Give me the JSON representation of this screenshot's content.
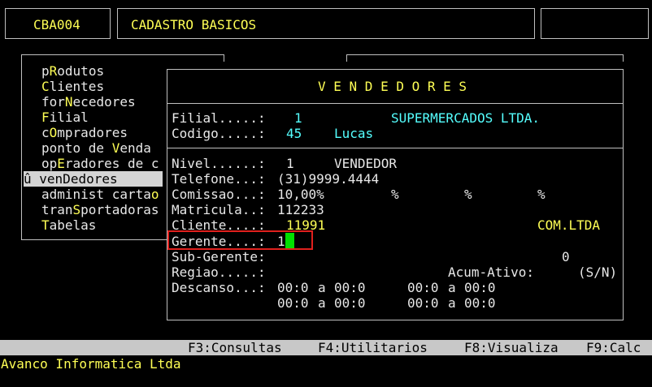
{
  "header": {
    "code": "CBA004",
    "title": "CADASTRO BASICOS"
  },
  "menu": {
    "items": [
      {
        "pre": "p",
        "key": "R",
        "post": "odutos"
      },
      {
        "pre": "",
        "key": "C",
        "post": "lientes"
      },
      {
        "pre": "for",
        "key": "N",
        "post": "ecedores"
      },
      {
        "pre": "",
        "key": "F",
        "post": "ilial"
      },
      {
        "pre": "c",
        "key": "O",
        "post": "mpradores"
      },
      {
        "pre": "ponto de ",
        "key": "V",
        "post": "enda"
      },
      {
        "pre": "op",
        "key": "E",
        "post": "radores de c"
      },
      {
        "pre": "",
        "key": "",
        "post": ""
      },
      {
        "pre": "administ carta",
        "key": "o",
        "post": ""
      },
      {
        "pre": "tran",
        "key": "S",
        "post": "portadoras"
      },
      {
        "pre": "",
        "key": "T",
        "post": "abelas"
      }
    ],
    "selected_marker": "û",
    "selected_label": "venDedores"
  },
  "dialog": {
    "title": "V E N D E D O R E S",
    "filial_label": "Filial.....:",
    "filial_value": "1",
    "filial_name": "SUPERMERCADOS LTDA.",
    "codigo_label": "Codigo.....:",
    "codigo_value": "45",
    "codigo_name": "Lucas",
    "nivel_label": "Nivel......:",
    "nivel_value": "1",
    "nivel_desc": "VENDEDOR",
    "telefone_label": "Telefone...:",
    "telefone_value": "(31)9999.4444",
    "comissao_label": "Comissao...:",
    "comissao_value": "10,00%",
    "pct1": "%",
    "pct2": "%",
    "pct3": "%",
    "matricula_label": "Matricula..:",
    "matricula_value": "112233",
    "cliente_label": "Cliente....:",
    "cliente_value": "11991",
    "cliente_name": "COM.LTDA",
    "gerente_label": "Gerente....:",
    "gerente_value": "1",
    "gerente_underscore": "_",
    "subgerente_label": "Sub-Gerente:",
    "subgerente_value": "0",
    "regiao_label": "Regiao.....:",
    "acum_label": "Acum-Ativo:",
    "acum_hint": "(S/N)",
    "descanso_label": "Descanso...:",
    "descanso_row1": [
      "00:0",
      "a",
      "00:0",
      "00:0",
      "a",
      "00:0"
    ],
    "descanso_row2": [
      "00:0",
      "a",
      "00:0",
      "00:0",
      "a",
      "00:0"
    ]
  },
  "statusbar": {
    "f3": "F3:Consultas",
    "f4": "F4:Utilitarios",
    "f8": "F8:Visualiza",
    "f9": "F9:Calc"
  },
  "footer": {
    "company": "Avanco Informatica Ltda"
  }
}
